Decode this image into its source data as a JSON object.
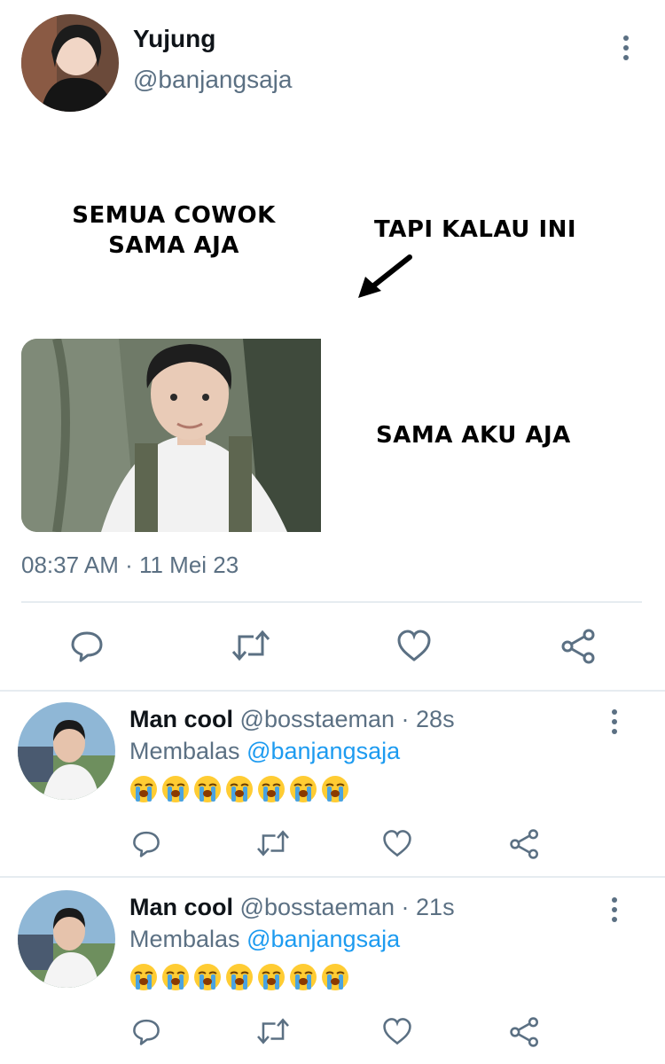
{
  "tweet": {
    "author_name": "Yujung",
    "author_handle": "@banjangsaja",
    "meme": {
      "text_left": "SEMUA COWOK SAMA AJA",
      "text_right_top": "TAPI KALAU INI",
      "text_right_bottom": "SAMA AKU AJA"
    },
    "timestamp": "08:37 AM · 11 Mei 23"
  },
  "replies": [
    {
      "name": "Man cool",
      "handle": "@bosstaeman",
      "age": "· 28s",
      "replying_label": "Membalas",
      "replying_to": "@banjangsaja"
    },
    {
      "name": "Man cool",
      "handle": "@bosstaeman",
      "age": "· 21s",
      "replying_label": "Membalas",
      "replying_to": "@banjangsaja"
    }
  ],
  "icons": [
    "reply-icon",
    "retweet-icon",
    "like-icon",
    "share-icon",
    "more-icon",
    "loudly-crying-face-emoji"
  ],
  "colors": {
    "link": "#1d9bf0",
    "muted": "#5b7083",
    "divider": "#e6ecf0"
  }
}
